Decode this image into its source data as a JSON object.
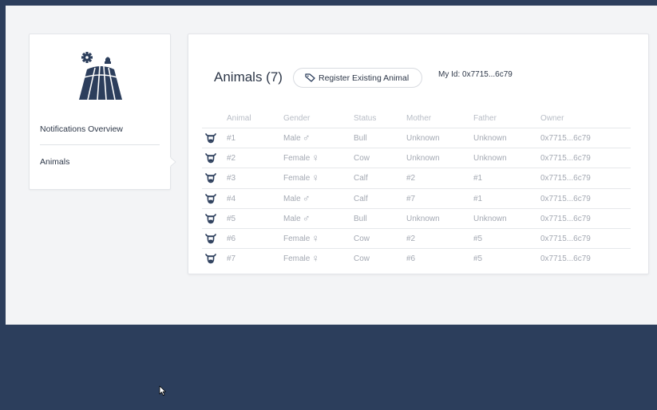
{
  "sidebar": {
    "items": [
      {
        "label": "Notifications Overview"
      },
      {
        "label": "Animals"
      }
    ]
  },
  "main": {
    "title": "Animals (7)",
    "register_button": "Register Existing Animal",
    "my_id": "My Id: 0x7715...6c79",
    "table": {
      "columns": [
        "Animal",
        "Gender",
        "Status",
        "Mother",
        "Father",
        "Owner"
      ],
      "rows": [
        {
          "animal": "#1",
          "gender": "Male",
          "gender_symbol": "♂",
          "status": "Bull",
          "mother": "Unknown",
          "father": "Unknown",
          "owner": "0x7715...6c79"
        },
        {
          "animal": "#2",
          "gender": "Female",
          "gender_symbol": "♀",
          "status": "Cow",
          "mother": "Unknown",
          "father": "Unknown",
          "owner": "0x7715...6c79"
        },
        {
          "animal": "#3",
          "gender": "Female",
          "gender_symbol": "♀",
          "status": "Calf",
          "mother": "#2",
          "father": "#1",
          "owner": "0x7715...6c79"
        },
        {
          "animal": "#4",
          "gender": "Male",
          "gender_symbol": "♂",
          "status": "Calf",
          "mother": "#7",
          "father": "#1",
          "owner": "0x7715...6c79"
        },
        {
          "animal": "#5",
          "gender": "Male",
          "gender_symbol": "♂",
          "status": "Bull",
          "mother": "Unknown",
          "father": "Unknown",
          "owner": "0x7715...6c79"
        },
        {
          "animal": "#6",
          "gender": "Female",
          "gender_symbol": "♀",
          "status": "Cow",
          "mother": "#2",
          "father": "#5",
          "owner": "0x7715...6c79"
        },
        {
          "animal": "#7",
          "gender": "Female",
          "gender_symbol": "♀",
          "status": "Cow",
          "mother": "#6",
          "father": "#5",
          "owner": "0x7715...6c79"
        }
      ]
    }
  },
  "icons": {
    "logo": "barn-field-gear-logo",
    "register": "tag-icon",
    "row": "cow-head-icon",
    "cursor": "mouse-pointer-icon"
  },
  "colors": {
    "navy": "#2c3e5c",
    "background": "#f3f4f6",
    "card": "#ffffff",
    "muted_text": "#a4a9b3",
    "header_text": "#b8bdc6"
  }
}
